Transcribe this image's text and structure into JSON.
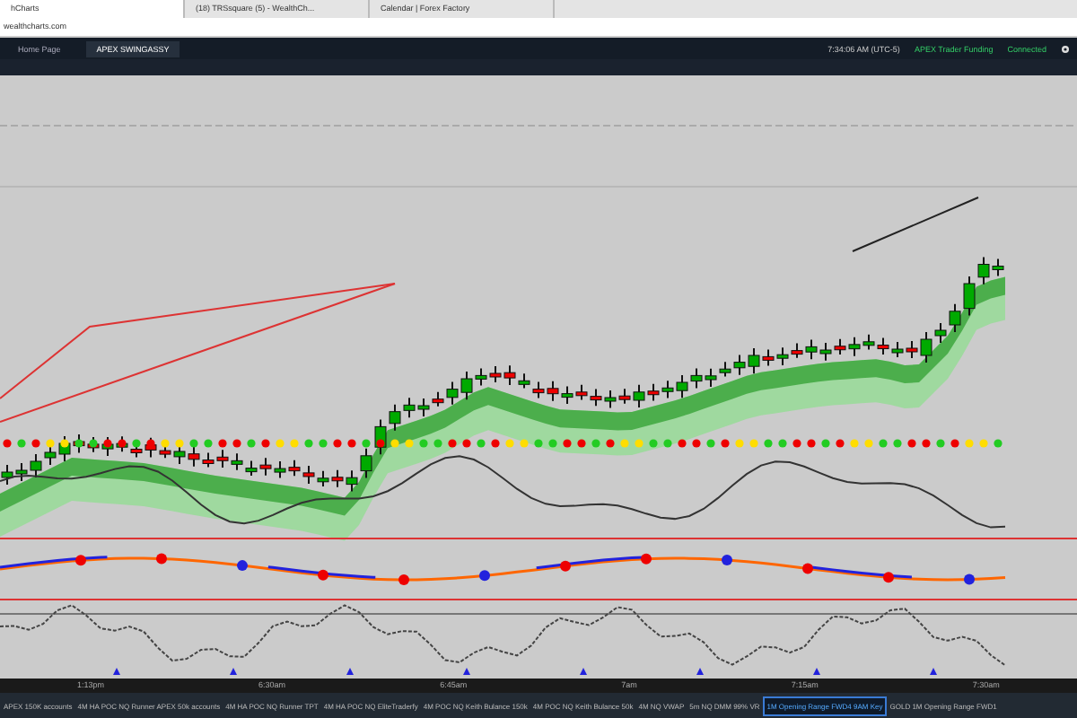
{
  "browser_tabs": [
    {
      "label": "hCharts",
      "selected": true
    },
    {
      "label": "(18) TRSsquare (5) - WealthCh...",
      "selected": false
    },
    {
      "label": "Calendar | Forex Factory",
      "selected": false
    }
  ],
  "address": "wealthcharts.com",
  "app_tabs": [
    {
      "label": "Home Page",
      "selected": false
    },
    {
      "label": "APEX SWINGASSY",
      "selected": true
    }
  ],
  "status": {
    "time": "7:34:06 AM (UTC-5)",
    "account": "APEX Trader Funding",
    "connection": "Connected"
  },
  "time_axis": [
    "1:13pm",
    "6:30am",
    "6:45am",
    "7am",
    "7:15am",
    "7:30am"
  ],
  "workspaces": [
    {
      "label": "APEX 150K accounts",
      "selected": false
    },
    {
      "label": "4M HA POC NQ Runner APEX 50k accounts",
      "selected": false
    },
    {
      "label": "4M HA POC NQ Runner TPT",
      "selected": false
    },
    {
      "label": "4M HA POC NQ EliteTraderfy",
      "selected": false
    },
    {
      "label": "4M POC NQ Keith Bulance 150k",
      "selected": false
    },
    {
      "label": "4M POC NQ Keith Bulance 50k",
      "selected": false
    },
    {
      "label": "4M NQ VWAP",
      "selected": false
    },
    {
      "label": "5m NQ DMM 99% VR",
      "selected": false
    },
    {
      "label": "1M Opening Range FWD4 9AM Key",
      "selected": true
    },
    {
      "label": "GOLD 1M Opening Range FWD1",
      "selected": false
    }
  ]
}
